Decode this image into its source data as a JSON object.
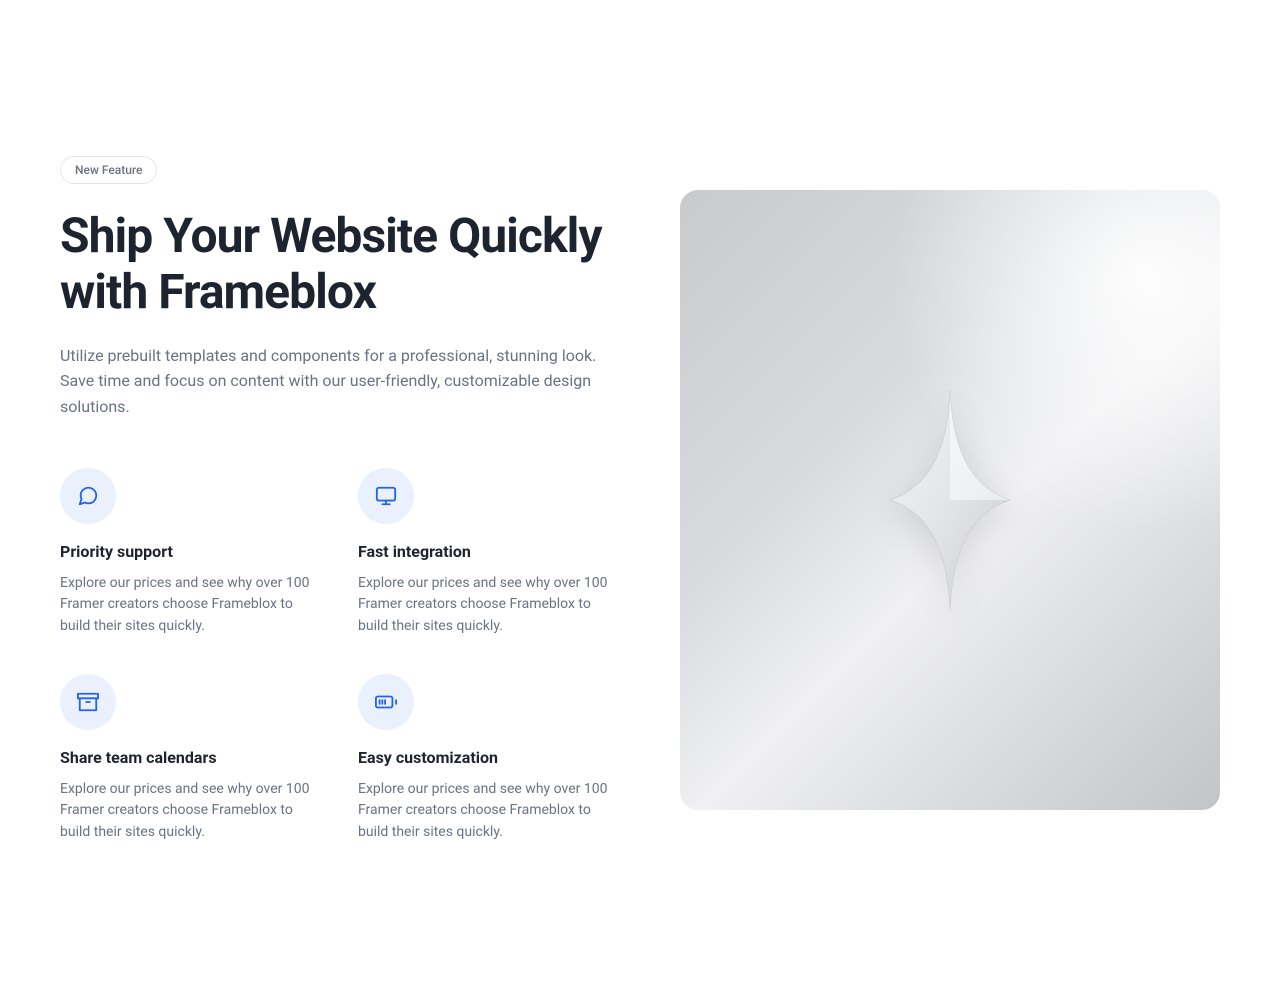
{
  "badge": "New Feature",
  "headline": "Ship Your Website Quickly with Frameblox",
  "subhead": "Utilize prebuilt templates and components for a professional, stunning look. Save time and focus on content with our user-friendly, customizable design solutions.",
  "features": [
    {
      "icon": "chat-bubble-icon",
      "title": "Priority support",
      "desc": "Explore our prices and see why over 100 Framer creators choose Frameblox to build their sites quickly."
    },
    {
      "icon": "monitor-icon",
      "title": "Fast integration",
      "desc": "Explore our prices and see why over 100 Framer creators choose Frameblox to build their sites quickly."
    },
    {
      "icon": "archive-icon",
      "title": "Share team calendars",
      "desc": "Explore our prices and see why over 100 Framer creators choose Frameblox to build their sites quickly."
    },
    {
      "icon": "battery-icon",
      "title": "Easy customization",
      "desc": "Explore our prices and see why over 100 Framer creators choose Frameblox to build their sites quickly."
    }
  ]
}
